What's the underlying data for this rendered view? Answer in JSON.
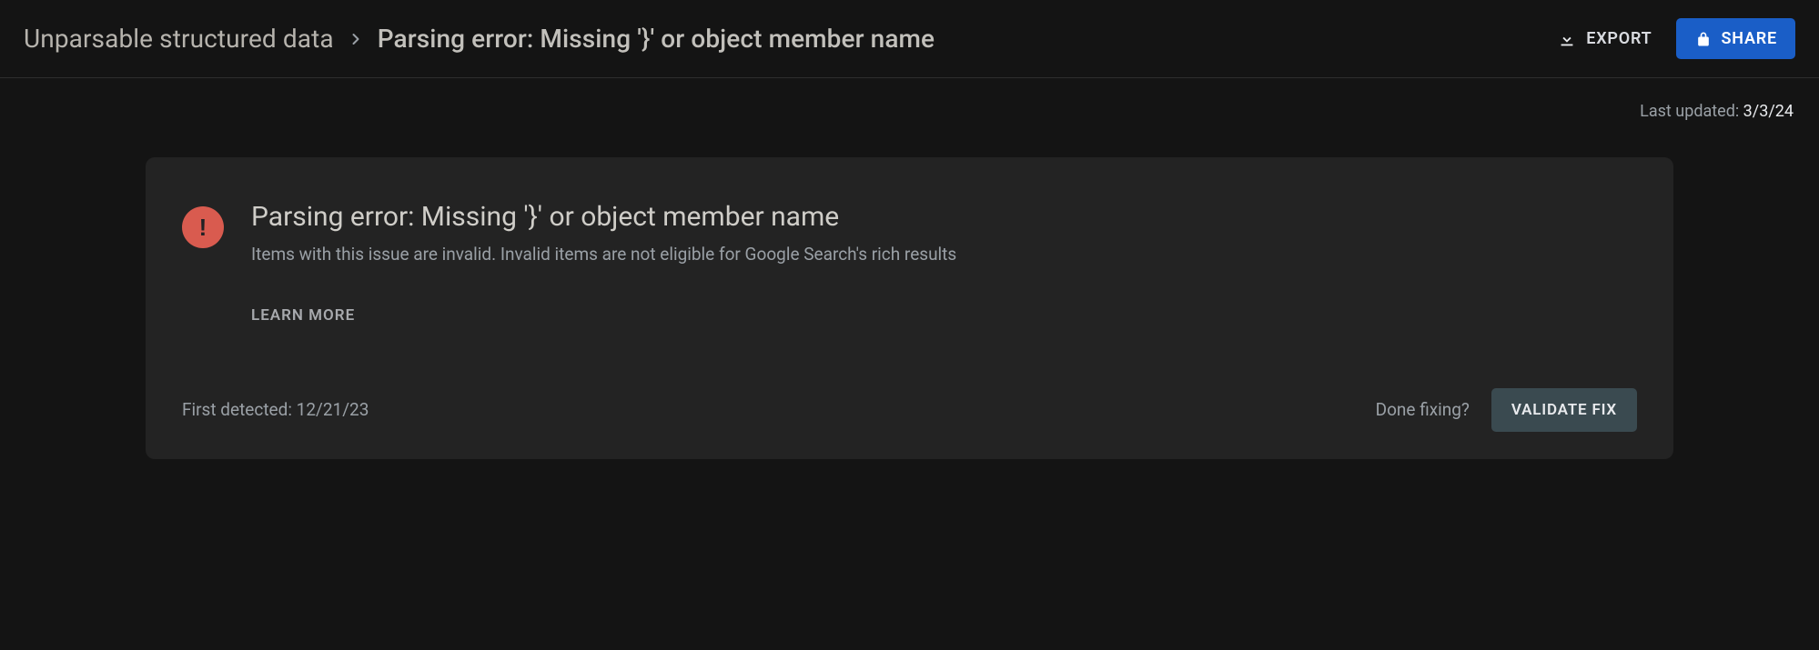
{
  "header": {
    "breadcrumb": {
      "root": "Unparsable structured data",
      "current": "Parsing error: Missing '}' or object member name"
    },
    "export_label": "EXPORT",
    "share_label": "SHARE"
  },
  "meta": {
    "last_updated_label": "Last updated: ",
    "last_updated_date": "3/3/24"
  },
  "card": {
    "title": "Parsing error: Missing '}' or object member name",
    "description": "Items with this issue are invalid. Invalid items are not eligible for Google Search's rich results",
    "learn_more_label": "LEARN MORE",
    "first_detected_label": "First detected: ",
    "first_detected_date": "12/21/23",
    "done_fixing_label": "Done fixing?",
    "validate_label": "VALIDATE FIX"
  },
  "icons": {
    "error": "!",
    "chevron": "›"
  }
}
